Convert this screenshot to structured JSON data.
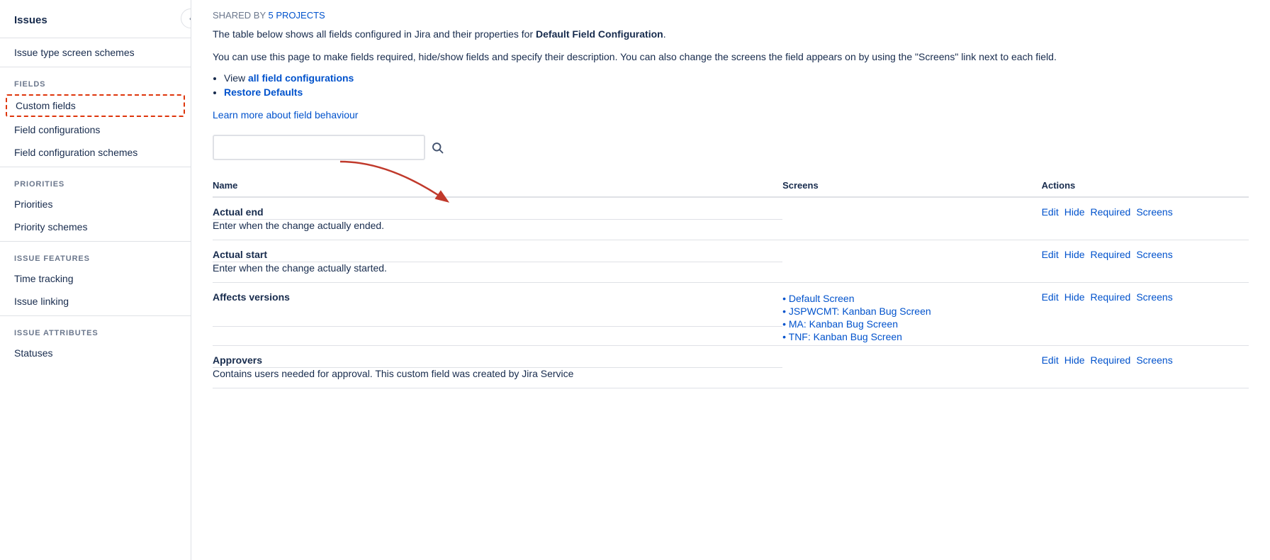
{
  "sidebar": {
    "title": "Issues",
    "items": [
      {
        "id": "issue-type-screen-schemes",
        "label": "Issue type screen schemes",
        "section": null,
        "active": false
      },
      {
        "id": "custom-fields",
        "label": "Custom fields",
        "section": "FIELDS",
        "active": true
      },
      {
        "id": "field-configurations",
        "label": "Field configurations",
        "section": null,
        "active": false
      },
      {
        "id": "field-configuration-schemes",
        "label": "Field configuration schemes",
        "section": null,
        "active": false
      },
      {
        "id": "priorities",
        "label": "Priorities",
        "section": "PRIORITIES",
        "active": false
      },
      {
        "id": "priority-schemes",
        "label": "Priority schemes",
        "section": null,
        "active": false
      },
      {
        "id": "time-tracking",
        "label": "Time tracking",
        "section": "ISSUE FEATURES",
        "active": false
      },
      {
        "id": "issue-linking",
        "label": "Issue linking",
        "section": null,
        "active": false
      },
      {
        "id": "statuses",
        "label": "Statuses",
        "section": "ISSUE ATTRIBUTES",
        "active": false
      }
    ],
    "collapse_icon": "‹"
  },
  "main": {
    "shared_banner": "SHARED BY 5 PROJECTS",
    "shared_banner_link": "#",
    "description1": "The table below shows all fields configured in Jira and their properties for ",
    "description1_bold": "Default Field Configuration",
    "description1_end": ".",
    "description2": "You can use this page to make fields required, hide/show fields and specify their description. You can also change the screens the field appears on by using the \"Screens\" link next to each field.",
    "bullet_links": [
      {
        "label": "View",
        "link_label": "all field configurations",
        "href": "#"
      },
      {
        "label": "Restore Defaults",
        "href": "#"
      }
    ],
    "learn_more": "Learn more about field behaviour",
    "learn_more_href": "#",
    "search": {
      "placeholder": "",
      "icon": "🔍"
    },
    "table": {
      "headers": [
        "Name",
        "Screens",
        "Actions"
      ],
      "rows": [
        {
          "name": "Actual end",
          "description": "Enter when the change actually ended.",
          "screens": [],
          "actions": [
            "Edit",
            "Hide",
            "Required",
            "Screens"
          ]
        },
        {
          "name": "Actual start",
          "description": "Enter when the change actually started.",
          "screens": [],
          "actions": [
            "Edit",
            "Hide",
            "Required",
            "Screens"
          ]
        },
        {
          "name": "Affects versions",
          "description": "",
          "screens": [
            "Default Screen",
            "JSPWCMT: Kanban Bug Screen",
            "MA: Kanban Bug Screen",
            "TNF: Kanban Bug Screen"
          ],
          "actions": [
            "Edit",
            "Hide",
            "Required",
            "Screens"
          ]
        },
        {
          "name": "Approvers",
          "description": "Contains users needed for approval. This custom field was created by Jira Service",
          "screens": [],
          "actions": [
            "Edit",
            "Hide",
            "Required",
            "Screens"
          ]
        }
      ]
    }
  }
}
